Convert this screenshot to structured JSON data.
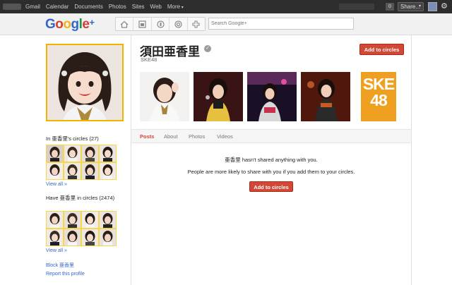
{
  "topbar": {
    "nav": [
      "Gmail",
      "Calendar",
      "Documents",
      "Photos",
      "Sites",
      "Web",
      "More"
    ],
    "notification_count": "0",
    "share_label": "Share..."
  },
  "header": {
    "logo": "Google+",
    "search_placeholder": "Search Google+",
    "nav_icons": [
      "home-icon",
      "photos-icon",
      "profile-icon",
      "circles-icon",
      "games-icon"
    ]
  },
  "profile": {
    "name": "須田亜香里",
    "subtitle": "SKE48",
    "add_to_circles": "Add to circles",
    "logo_text": "SKE\n48"
  },
  "sidebar": {
    "in_circles_title": "In 亜香里's circles (27)",
    "view_all_1": "View all »",
    "have_in_circles_title": "Have 亜香里 in circles (2474)",
    "view_all_2": "View all »",
    "block": "Block 亜香里",
    "report": "Report this profile"
  },
  "tabs": [
    "Posts",
    "About",
    "Photos",
    "Videos"
  ],
  "active_tab": "Posts",
  "stream": {
    "empty_message": "亜香里 hasn't shared anything with you.",
    "empty_sub": "People are more likely to share with you if you add them to your circles.",
    "add_to_circles": "Add to circles"
  },
  "colors": {
    "accent_red": "#d14836",
    "link_blue": "#3366cc",
    "photo_border_gold": "#f0b400",
    "ske_orange": "#f0a020"
  }
}
